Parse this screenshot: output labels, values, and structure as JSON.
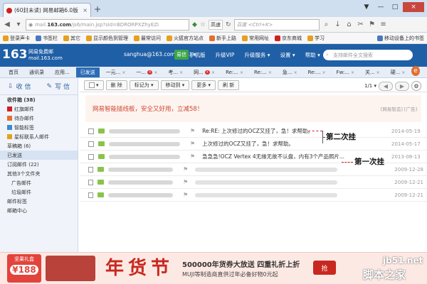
{
  "browser": {
    "tab_title": "(60封未读) 网易邮箱6.0版",
    "tab_close": "×",
    "new_tab": "+",
    "win_buttons": [
      "▼",
      "—",
      "□",
      "×"
    ],
    "url_prefix": "mail.",
    "url_host": "163.com",
    "url_path": "/js6/main.jsp?sid=BDRORPXZhyEZI",
    "mode_label": "高速",
    "search_placeholder": "百度 <Ctrl+K>"
  },
  "bookmarks": [
    {
      "label": "登录声卡",
      "color": "#e5a020"
    },
    {
      "label": "书签栏",
      "color": "#4a78c0"
    },
    {
      "label": "其它",
      "color": "#e5a020"
    },
    {
      "label": "显示颜色到管理",
      "color": "#e5a020"
    },
    {
      "label": "最常访问",
      "color": "#e5a020"
    },
    {
      "label": "火狐官方站点",
      "color": "#e5a020"
    },
    {
      "label": "新手上路",
      "color": "#e07030"
    },
    {
      "label": "常用网址",
      "color": "#e5a020"
    },
    {
      "label": "京东商城",
      "color": "#d02020"
    },
    {
      "label": "学习",
      "color": "#e5a020"
    },
    {
      "label": "移动设备上的书签",
      "color": "#4a78c0"
    }
  ],
  "mail_header": {
    "logo": "163",
    "logo_sub1": "网易免费邮",
    "logo_sub2": "mail.163.com",
    "account": "sanghua@163.com (174) ▾",
    "yixin": "易信",
    "links": [
      "手机版",
      "升级VIP",
      "升级服务 ▾",
      "设置 ▾",
      "帮助 ▾"
    ],
    "search_placeholder": "支持邮件全文搜索"
  },
  "mail_tabs": [
    {
      "label": "首页",
      "active": false
    },
    {
      "label": "通讯录",
      "active": false
    },
    {
      "label": "应用...",
      "active": false
    },
    {
      "label": "已发送",
      "active": true
    },
    {
      "label": "一元...",
      "active": false
    },
    {
      "label": "一...",
      "active": false,
      "badge": "•"
    },
    {
      "label": "考...",
      "active": false
    },
    {
      "label": "网...",
      "active": false,
      "badge": "•"
    },
    {
      "label": "Re:...",
      "active": false
    },
    {
      "label": "Re:...",
      "active": false
    },
    {
      "label": "急...",
      "active": false
    },
    {
      "label": "Re:...",
      "active": false
    },
    {
      "label": "Fw:...",
      "active": false
    },
    {
      "label": "关...",
      "active": false
    },
    {
      "label": "硬...",
      "active": false
    }
  ],
  "sidebar": {
    "receive": "收 信",
    "write": "写 信",
    "items": [
      {
        "label": "收件箱 (38)",
        "bold": true,
        "color": ""
      },
      {
        "label": "红旗邮件",
        "bold": false,
        "color": "#d02020"
      },
      {
        "label": "待办邮件",
        "bold": false,
        "color": "#e07030"
      },
      {
        "label": "智能标签",
        "bold": false,
        "color": "#3a8ad0"
      },
      {
        "label": "星标联系人邮件",
        "bold": false,
        "color": "#e5a020"
      },
      {
        "label": "草稿箱 (6)",
        "bold": false,
        "color": ""
      },
      {
        "label": "已发送",
        "bold": false,
        "color": "",
        "active": true
      },
      {
        "label": "订阅邮件 (22)",
        "bold": false,
        "color": ""
      },
      {
        "label": "其他3个文件夹",
        "bold": false,
        "color": ""
      },
      {
        "label": "广告邮件",
        "bold": false,
        "color": "",
        "indent": true
      },
      {
        "label": "垃圾邮件",
        "bold": false,
        "color": "",
        "indent": true
      },
      {
        "label": "邮件标签",
        "bold": false,
        "color": ""
      },
      {
        "label": "邮箱中心",
        "bold": false,
        "color": ""
      }
    ]
  },
  "toolbar": {
    "buttons": [
      "删 除",
      "标记为 ▾",
      "移动到 ▾",
      "更多 ▾",
      "刷 新"
    ],
    "page": "1/1 ▾",
    "prev": "◀",
    "next": "▶",
    "gear": "⚙"
  },
  "ad_line": {
    "text": "网易智能插线板，安全又好用，立减58！",
    "tag": "[网易智造] [广告]"
  },
  "emails": [
    {
      "subject": "Re:RE: 上次修过的OCZ又挂了，急！求帮助。",
      "snippet": "",
      "date": "2014-05-19"
    },
    {
      "subject": "上次修过的OCZ又挂了，急！求帮助。",
      "snippet": "",
      "date": "2014-05-17"
    },
    {
      "subject": "急急急!OCZ Vertex 4无缘无故不认盘，内有3个产品照片...",
      "snippet": "",
      "date": "2013-08-13"
    },
    {
      "subject": "",
      "snippet": "",
      "date": "2009-12-28"
    },
    {
      "subject": "",
      "snippet": "",
      "date": "2009-12-21"
    },
    {
      "subject": "",
      "snippet": "",
      "date": "2009-12-21"
    }
  ],
  "annotations": {
    "second": "第二次挂",
    "first": "第一次挂"
  },
  "banner": {
    "left_top": "坚果礼盒",
    "left_price": "¥188",
    "title": "年货节",
    "line1": "500000年货券大放送  四重礼折上折",
    "line2": "MUJI等制造商直供过年必备好物0元起",
    "button": "抢"
  },
  "watermark": {
    "line1": "jb51.net",
    "line2": "脚本之家"
  }
}
